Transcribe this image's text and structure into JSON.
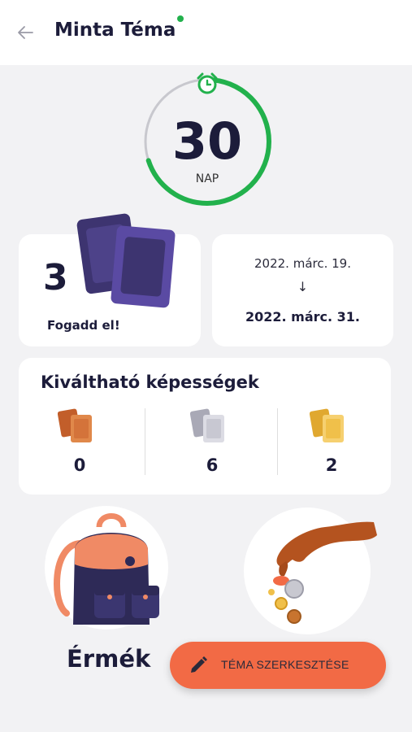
{
  "header": {
    "back_icon": "arrow-left-icon",
    "title": "Minta Téma",
    "status_color": "#22b14c"
  },
  "timer": {
    "value": "30",
    "unit": "NAP",
    "progress": 0.7,
    "progress_color": "#22b14c",
    "icon": "alarm-clock-icon"
  },
  "accept_card": {
    "count": "3",
    "label": "Fogadd el!"
  },
  "date_card": {
    "start": "2022. márc. 19.",
    "arrow": "↓",
    "end": "2022. márc. 31."
  },
  "abilities": {
    "title": "Kiváltható képességek",
    "items": [
      {
        "tier": "bronze",
        "value": "0",
        "color": "#d4733a"
      },
      {
        "tier": "silver",
        "value": "6",
        "color": "#c8c8d2"
      },
      {
        "tier": "gold",
        "value": "2",
        "color": "#f0c04a"
      }
    ]
  },
  "coins": {
    "label": "Érmék"
  },
  "edit_button": {
    "label": "TÉMA SZERKESZTÉSE",
    "icon": "pencil-icon",
    "color": "#f26a45"
  }
}
